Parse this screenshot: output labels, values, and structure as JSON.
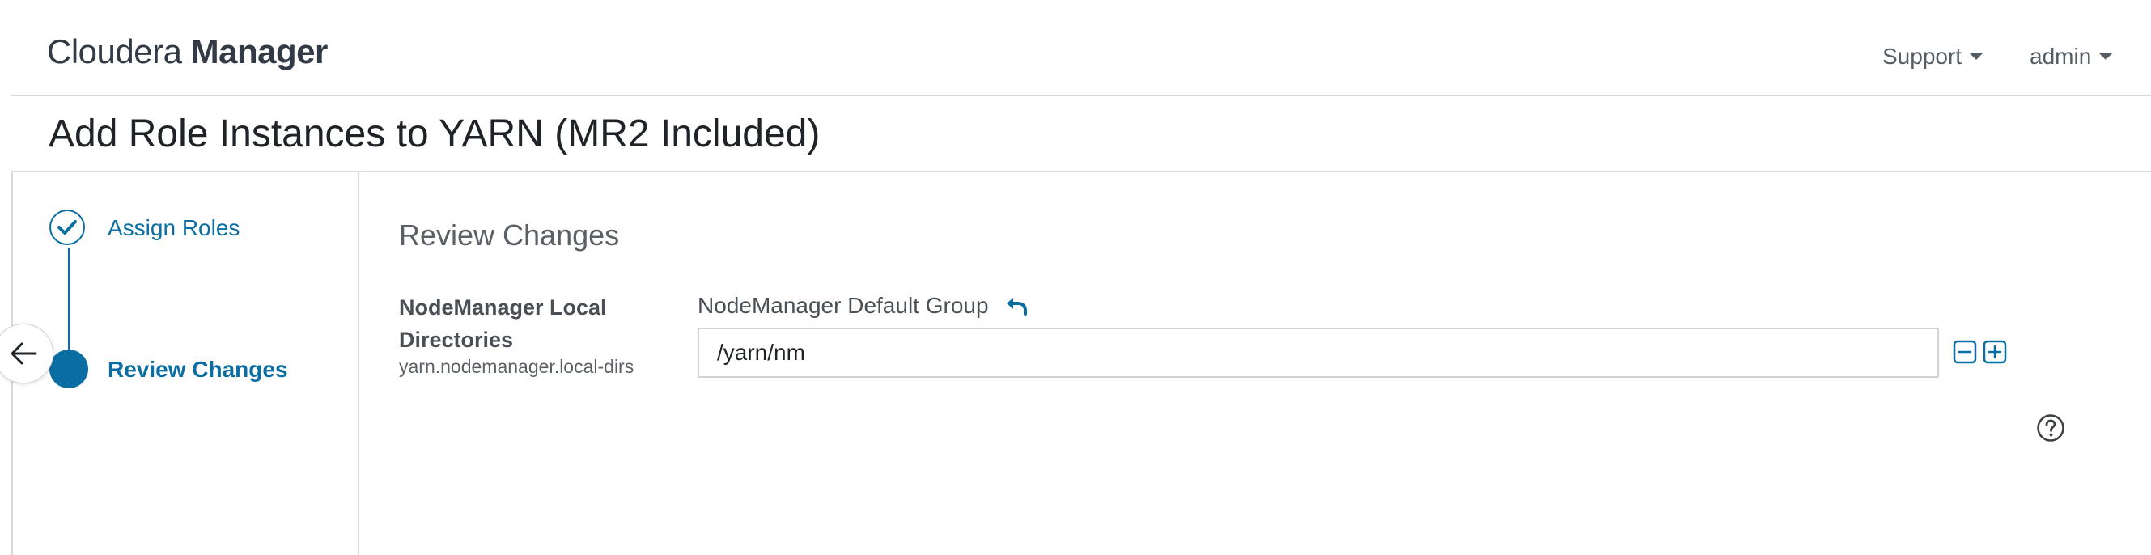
{
  "header": {
    "brand_light": "Cloudera",
    "brand_bold": "Manager",
    "support_label": "Support",
    "user_label": "admin"
  },
  "page": {
    "title": "Add Role Instances to YARN (MR2 Included)"
  },
  "wizard": {
    "steps": [
      {
        "label": "Assign Roles",
        "status": "complete"
      },
      {
        "label": "Review Changes",
        "status": "current"
      }
    ]
  },
  "main": {
    "section_title": "Review Changes",
    "property": {
      "display_name": "NodeManager Local Directories",
      "key": "yarn.nodemanager.local-dirs",
      "group": "NodeManager Default Group",
      "value": "/yarn/nm"
    }
  },
  "colors": {
    "accent": "#0a6ea3",
    "border": "#d7d9db",
    "text": "#3b3f44"
  },
  "icons": [
    "caret-down-icon",
    "check-icon",
    "arrow-left-icon",
    "undo-icon",
    "minus-square-icon",
    "plus-square-icon",
    "help-circle-icon"
  ]
}
